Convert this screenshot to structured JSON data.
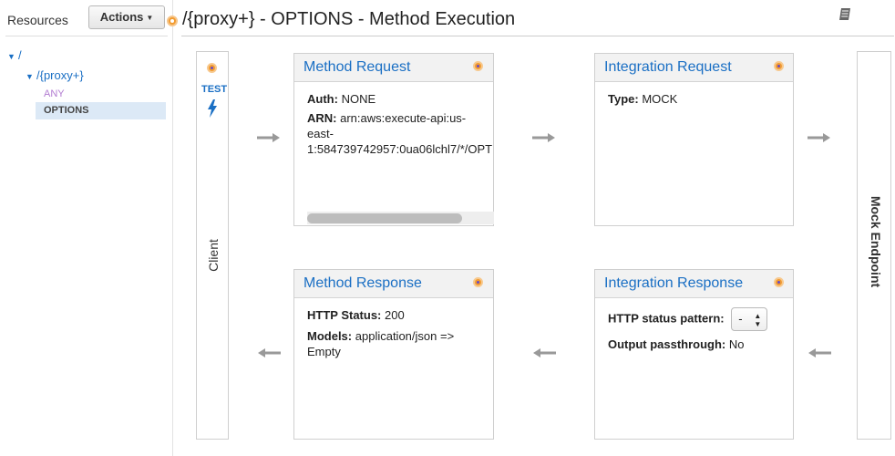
{
  "sidebar": {
    "resources_label": "Resources",
    "actions_label": "Actions",
    "tree": {
      "root": "/",
      "proxy": "/{proxy+}",
      "method_any": "ANY",
      "method_options": "OPTIONS"
    }
  },
  "header": {
    "title": "/{proxy+} - OPTIONS - Method Execution"
  },
  "client": {
    "test_label": "TEST",
    "label": "Client"
  },
  "endpoint": {
    "label": "Mock Endpoint"
  },
  "method_request": {
    "title": "Method Request",
    "auth_key": "Auth:",
    "auth_value": "NONE",
    "arn_key": "ARN:",
    "arn_line1": "arn:aws:execute-api:us-",
    "arn_line2": "east-",
    "arn_line3": "1:584739742957:0ua06lchl7/*/OPT"
  },
  "integration_request": {
    "title": "Integration Request",
    "type_key": "Type:",
    "type_value": "MOCK"
  },
  "method_response": {
    "title": "Method Response",
    "status_key": "HTTP Status:",
    "status_value": "200",
    "models_key": "Models:",
    "models_line1": "application/json =>",
    "models_line2": "Empty"
  },
  "integration_response": {
    "title": "Integration Response",
    "pattern_key": "HTTP status pattern:",
    "pattern_value": "-",
    "passthrough_key": "Output passthrough:",
    "passthrough_value": "No"
  },
  "colors": {
    "link": "#1a6fc4",
    "accent_orange": "#f29b2f",
    "any_purple": "#b27cd1",
    "selected_row": "#dce9f6"
  },
  "icons": [
    "book-icon",
    "lightning-icon",
    "settings-dot-icon",
    "arrow-right-icon",
    "arrow-left-icon",
    "caret-down-icon"
  ]
}
